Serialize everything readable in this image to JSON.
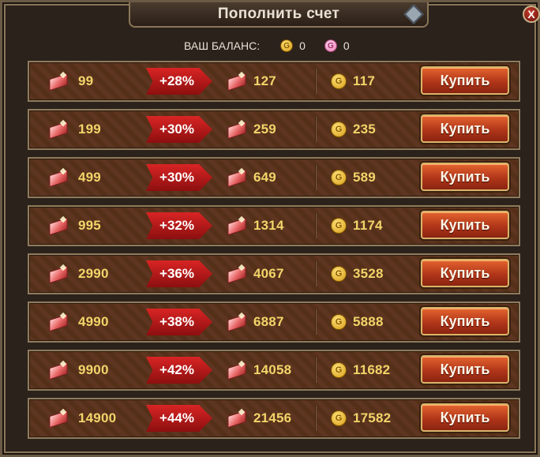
{
  "window": {
    "title": "Пополнить счет",
    "close_label": "X"
  },
  "balance": {
    "label": "ВАШ БАЛАНС:",
    "gold_icon_text": "G",
    "gold_value": "0",
    "pink_icon_text": "G",
    "pink_value": "0"
  },
  "offers": [
    {
      "price": "99",
      "bonus": "+28%",
      "amount": "127",
      "gold": "117",
      "buy_label": "Купить"
    },
    {
      "price": "199",
      "bonus": "+30%",
      "amount": "259",
      "gold": "235",
      "buy_label": "Купить"
    },
    {
      "price": "499",
      "bonus": "+30%",
      "amount": "649",
      "gold": "589",
      "buy_label": "Купить"
    },
    {
      "price": "995",
      "bonus": "+32%",
      "amount": "1314",
      "gold": "1174",
      "buy_label": "Купить"
    },
    {
      "price": "2990",
      "bonus": "+36%",
      "amount": "4067",
      "gold": "3528",
      "buy_label": "Купить"
    },
    {
      "price": "4990",
      "bonus": "+38%",
      "amount": "6887",
      "gold": "5888",
      "buy_label": "Купить"
    },
    {
      "price": "9900",
      "bonus": "+42%",
      "amount": "14058",
      "gold": "11682",
      "buy_label": "Купить"
    },
    {
      "price": "14900",
      "bonus": "+44%",
      "amount": "21456",
      "gold": "17582",
      "buy_label": "Купить"
    }
  ],
  "coin_icon_text": "G",
  "colors": {
    "accent_gold": "#f2d56a",
    "bonus_red": "#d92424",
    "button_orange": "#e4632e"
  }
}
